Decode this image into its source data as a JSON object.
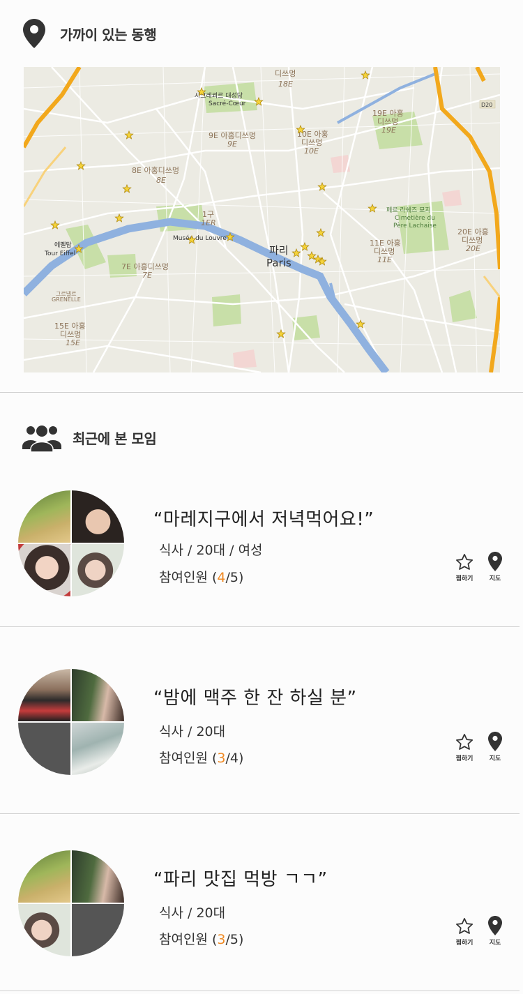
{
  "nearby": {
    "title": "가까이 있는 동행",
    "icon": "location-pin-icon",
    "map": {
      "labels": {
        "d18": "18E",
        "dissmyeong_top": "디쓰멍",
        "sacre_kr": "사크레쾨르 대성당",
        "sacre_fr": "Sacré-Cœur",
        "d9": "9E 아홍디쓰멍",
        "d9b": "9E",
        "d10": "10E 아홍",
        "d10b": "디쓰멍",
        "d10c": "10E",
        "d19": "19E 아홍",
        "d19b": "디쓰멍",
        "d19c": "19E",
        "d8": "8E 아홍디쓰멍",
        "d8b": "8E",
        "d1": "1구",
        "d1b": "1ER",
        "louvre": "Musée du Louvre",
        "paris_kr": "파리",
        "paris_fr": "Paris",
        "pere_kr": "페르 라쉐즈 묘지",
        "pere_fr1": "Cimetière du",
        "pere_fr2": "Père Lachaise",
        "d20": "20E 아홍",
        "d20b": "디쓰멍",
        "d20c": "20E",
        "d11": "11E 아홍",
        "d11b": "디쓰멍",
        "d11c": "11E",
        "d7": "7E 아홍디쓰멍",
        "d7b": "7E",
        "eiffel1": "에펠탑",
        "eiffel2": "Tour Eiffel",
        "grenelle1": "그르넬르",
        "grenelle2": "GRENELLE",
        "d15": "15E 아홍",
        "d15b": "디쓰멍",
        "d15c": "15E",
        "road_d20": "D20"
      }
    }
  },
  "recent": {
    "title": "최근에 본 모임",
    "icon": "group-icon"
  },
  "meetups": [
    {
      "title": "“마레지구에서 저녁먹어요!”",
      "tags": "식사 / 20대 / 여성",
      "count_prefix": "참여인원 (",
      "count_current": "4",
      "count_suffix": "/5)",
      "favorite_label": "찜하기",
      "map_label": "지도"
    },
    {
      "title": "“밤에 맥주 한 잔 하실 분”",
      "tags": "식사 / 20대",
      "count_prefix": "참여인원 (",
      "count_current": "3",
      "count_suffix": "/4)",
      "favorite_label": "찜하기",
      "map_label": "지도"
    },
    {
      "title": "“파리 맛집 먹방 ㄱㄱ”",
      "tags": "식사 / 20대",
      "count_prefix": "참여인원 (",
      "count_current": "3",
      "count_suffix": "/5)",
      "favorite_label": "찜하기",
      "map_label": "지도"
    }
  ],
  "colors": {
    "accent": "#f08a24",
    "divider": "#cfcfcf",
    "map_bg": "#ecebe3",
    "river": "#8fb1df",
    "park": "#c8dfa8",
    "highway": "#f2a81c"
  }
}
